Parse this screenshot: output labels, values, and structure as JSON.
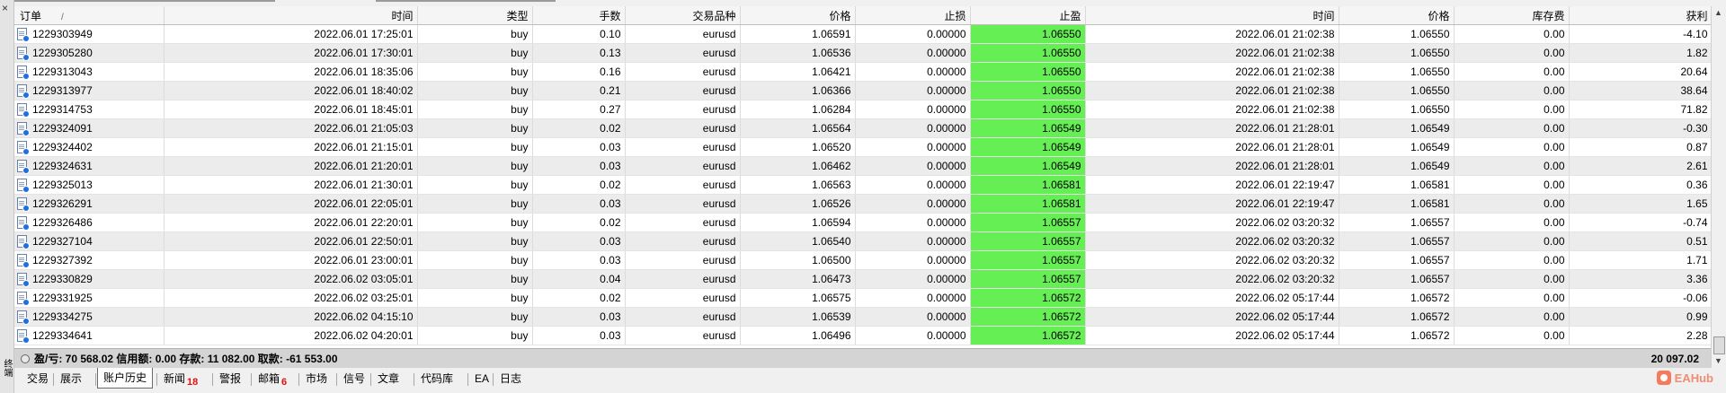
{
  "side_panel": {
    "close_glyph": "×",
    "label": "终端"
  },
  "columns": [
    "订单",
    "时间",
    "类型",
    "手数",
    "交易品种",
    "价格",
    "止损",
    "止盈",
    "时间",
    "价格",
    "库存费",
    "获利"
  ],
  "sort_indicator": "/",
  "rows": [
    [
      "1229303949",
      "2022.06.01 17:25:01",
      "buy",
      "0.10",
      "eurusd",
      "1.06591",
      "0.00000",
      "1.06550",
      "2022.06.01 21:02:38",
      "1.06550",
      "0.00",
      "-4.10"
    ],
    [
      "1229305280",
      "2022.06.01 17:30:01",
      "buy",
      "0.13",
      "eurusd",
      "1.06536",
      "0.00000",
      "1.06550",
      "2022.06.01 21:02:38",
      "1.06550",
      "0.00",
      "1.82"
    ],
    [
      "1229313043",
      "2022.06.01 18:35:06",
      "buy",
      "0.16",
      "eurusd",
      "1.06421",
      "0.00000",
      "1.06550",
      "2022.06.01 21:02:38",
      "1.06550",
      "0.00",
      "20.64"
    ],
    [
      "1229313977",
      "2022.06.01 18:40:02",
      "buy",
      "0.21",
      "eurusd",
      "1.06366",
      "0.00000",
      "1.06550",
      "2022.06.01 21:02:38",
      "1.06550",
      "0.00",
      "38.64"
    ],
    [
      "1229314753",
      "2022.06.01 18:45:01",
      "buy",
      "0.27",
      "eurusd",
      "1.06284",
      "0.00000",
      "1.06550",
      "2022.06.01 21:02:38",
      "1.06550",
      "0.00",
      "71.82"
    ],
    [
      "1229324091",
      "2022.06.01 21:05:03",
      "buy",
      "0.02",
      "eurusd",
      "1.06564",
      "0.00000",
      "1.06549",
      "2022.06.01 21:28:01",
      "1.06549",
      "0.00",
      "-0.30"
    ],
    [
      "1229324402",
      "2022.06.01 21:15:01",
      "buy",
      "0.03",
      "eurusd",
      "1.06520",
      "0.00000",
      "1.06549",
      "2022.06.01 21:28:01",
      "1.06549",
      "0.00",
      "0.87"
    ],
    [
      "1229324631",
      "2022.06.01 21:20:01",
      "buy",
      "0.03",
      "eurusd",
      "1.06462",
      "0.00000",
      "1.06549",
      "2022.06.01 21:28:01",
      "1.06549",
      "0.00",
      "2.61"
    ],
    [
      "1229325013",
      "2022.06.01 21:30:01",
      "buy",
      "0.02",
      "eurusd",
      "1.06563",
      "0.00000",
      "1.06581",
      "2022.06.01 22:19:47",
      "1.06581",
      "0.00",
      "0.36"
    ],
    [
      "1229326291",
      "2022.06.01 22:05:01",
      "buy",
      "0.03",
      "eurusd",
      "1.06526",
      "0.00000",
      "1.06581",
      "2022.06.01 22:19:47",
      "1.06581",
      "0.00",
      "1.65"
    ],
    [
      "1229326486",
      "2022.06.01 22:20:01",
      "buy",
      "0.02",
      "eurusd",
      "1.06594",
      "0.00000",
      "1.06557",
      "2022.06.02 03:20:32",
      "1.06557",
      "0.00",
      "-0.74"
    ],
    [
      "1229327104",
      "2022.06.01 22:50:01",
      "buy",
      "0.03",
      "eurusd",
      "1.06540",
      "0.00000",
      "1.06557",
      "2022.06.02 03:20:32",
      "1.06557",
      "0.00",
      "0.51"
    ],
    [
      "1229327392",
      "2022.06.01 23:00:01",
      "buy",
      "0.03",
      "eurusd",
      "1.06500",
      "0.00000",
      "1.06557",
      "2022.06.02 03:20:32",
      "1.06557",
      "0.00",
      "1.71"
    ],
    [
      "1229330829",
      "2022.06.02 03:05:01",
      "buy",
      "0.04",
      "eurusd",
      "1.06473",
      "0.00000",
      "1.06557",
      "2022.06.02 03:20:32",
      "1.06557",
      "0.00",
      "3.36"
    ],
    [
      "1229331925",
      "2022.06.02 03:25:01",
      "buy",
      "0.02",
      "eurusd",
      "1.06575",
      "0.00000",
      "1.06572",
      "2022.06.02 05:17:44",
      "1.06572",
      "0.00",
      "-0.06"
    ],
    [
      "1229334275",
      "2022.06.02 04:15:10",
      "buy",
      "0.03",
      "eurusd",
      "1.06539",
      "0.00000",
      "1.06572",
      "2022.06.02 05:17:44",
      "1.06572",
      "0.00",
      "0.99"
    ],
    [
      "1229334641",
      "2022.06.02 04:20:01",
      "buy",
      "0.03",
      "eurusd",
      "1.06496",
      "0.00000",
      "1.06572",
      "2022.06.02 05:17:44",
      "1.06572",
      "0.00",
      "2.28"
    ]
  ],
  "summary": {
    "text": "盈/亏: 70 568.02   信用额: 0.00   存款: 11 082.00   取款: -61 553.00",
    "total": "20 097.02"
  },
  "tabs": [
    {
      "label": "交易",
      "badge": ""
    },
    {
      "label": "展示",
      "badge": ""
    },
    {
      "label": "账户历史",
      "badge": "",
      "active": true
    },
    {
      "label": "新闻",
      "badge": "18"
    },
    {
      "label": "警报",
      "badge": ""
    },
    {
      "label": "邮箱",
      "badge": "6"
    },
    {
      "label": "市场",
      "badge": ""
    },
    {
      "label": "信号",
      "badge": ""
    },
    {
      "label": "文章",
      "badge": ""
    },
    {
      "label": "代码库",
      "badge": ""
    },
    {
      "label": "EA",
      "badge": ""
    },
    {
      "label": "日志",
      "badge": ""
    }
  ],
  "logo": {
    "text": "EAHub"
  },
  "colors": {
    "take_profit_highlight": "#66ee55",
    "alt_row": "#ececec",
    "badge": "#e01010",
    "order_icon_dot": "#1e6fe0"
  },
  "icons": {
    "order_row": "closed-order-icon",
    "summary": "balance-circle-icon"
  }
}
